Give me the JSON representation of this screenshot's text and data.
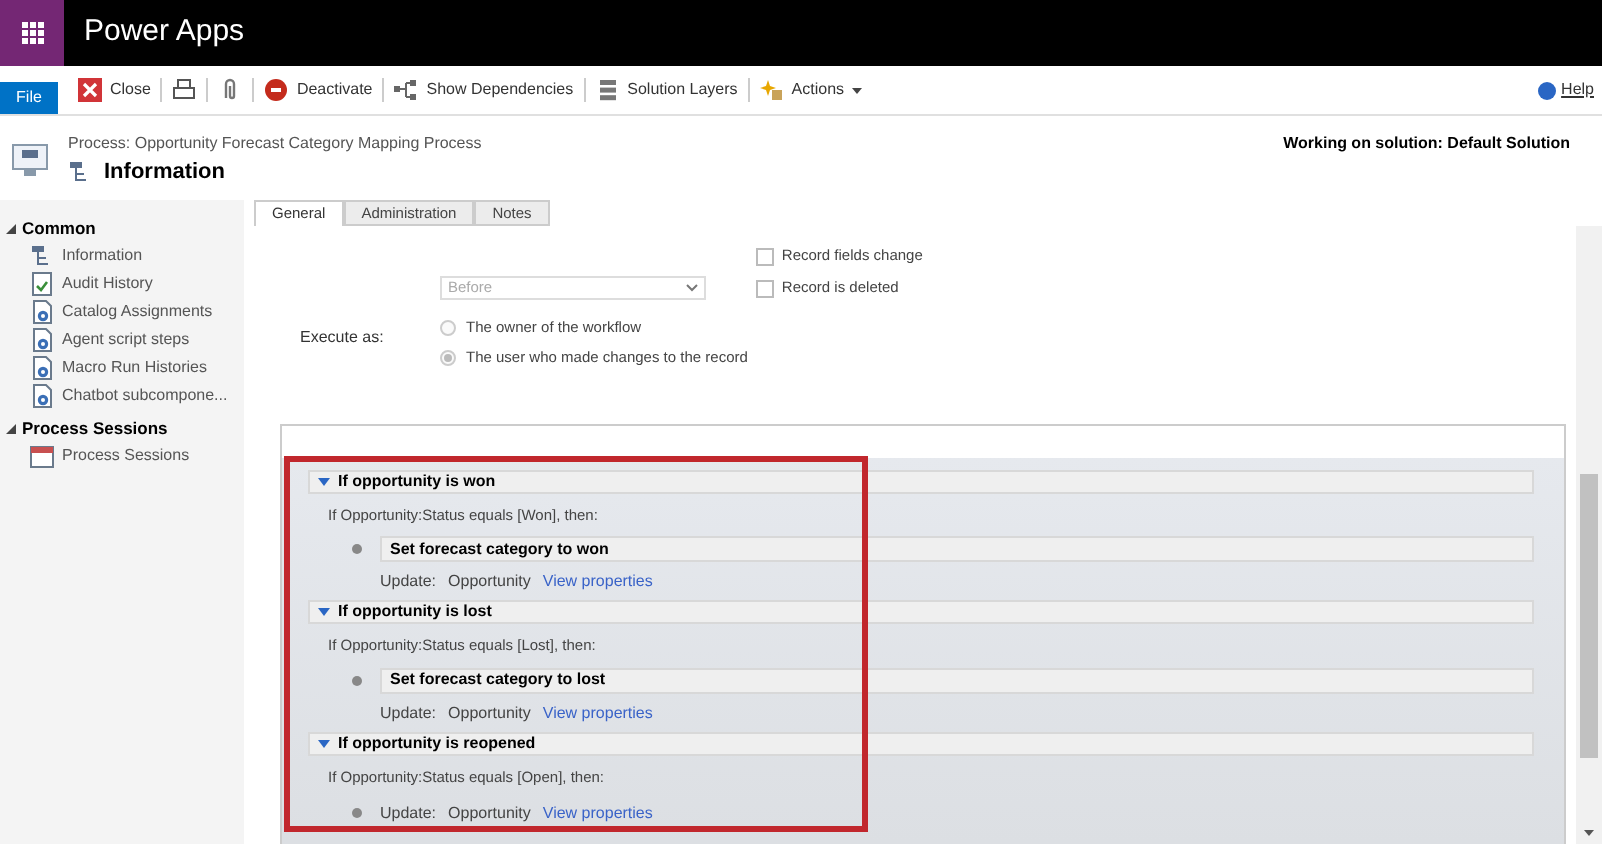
{
  "app": {
    "title": "Power Apps"
  },
  "toolbar": {
    "file": "File",
    "items": [
      {
        "kind": "close",
        "label": "Close"
      },
      {
        "kind": "print"
      },
      {
        "kind": "attach"
      },
      {
        "kind": "deactivate",
        "label": "Deactivate"
      },
      {
        "kind": "dependencies",
        "label": "Show Dependencies"
      },
      {
        "kind": "layers",
        "label": "Solution Layers"
      },
      {
        "kind": "actions",
        "label": "Actions"
      }
    ],
    "help": "Help"
  },
  "header": {
    "breadcrumb": "Process: Opportunity Forecast Category Mapping Process",
    "title": "Information",
    "solution": "Working on solution: Default Solution"
  },
  "sidebar": {
    "sections": [
      {
        "label": "Common",
        "expanded": true,
        "items": [
          {
            "kind": "info",
            "label": "Information"
          },
          {
            "kind": "audit",
            "label": "Audit History"
          },
          {
            "kind": "entity",
            "label": "Catalog Assignments"
          },
          {
            "kind": "entity",
            "label": "Agent script steps"
          },
          {
            "kind": "entity",
            "label": "Macro Run Histories"
          },
          {
            "kind": "entity",
            "label": "Chatbot subcompone..."
          }
        ]
      },
      {
        "label": "Process Sessions",
        "expanded": true,
        "items": [
          {
            "kind": "sessions",
            "label": "Process Sessions"
          }
        ]
      }
    ]
  },
  "tabs": [
    {
      "label": "General",
      "selected": true
    },
    {
      "label": "Administration",
      "selected": false
    },
    {
      "label": "Notes",
      "selected": false
    }
  ],
  "form": {
    "checkboxes": [
      {
        "label": "Record fields change",
        "checked": false
      },
      {
        "label": "Record is deleted",
        "checked": false
      }
    ],
    "dropdown": {
      "value": "Before",
      "disabled": true
    },
    "execute_as": {
      "label": "Execute as:",
      "options": [
        {
          "label": "The owner of the workflow",
          "selected": false
        },
        {
          "label": "The user who made changes to the record",
          "selected": true
        }
      ]
    }
  },
  "steps": [
    {
      "title": "If opportunity is won",
      "expanded": true,
      "condition": "If Opportunity:Status equals [Won], then:",
      "actions": [
        {
          "kind": "step",
          "title": "Set forecast category to won",
          "entity_label": "Update:",
          "entity": "Opportunity",
          "link": "View properties"
        }
      ]
    },
    {
      "title": "If opportunity is lost",
      "expanded": true,
      "condition": "If Opportunity:Status equals [Lost], then:",
      "actions": [
        {
          "kind": "step",
          "title": "Set forecast category to lost",
          "entity_label": "Update:",
          "entity": "Opportunity",
          "link": "View properties"
        }
      ]
    },
    {
      "title": "If opportunity is reopened",
      "expanded": true,
      "condition": "If Opportunity:Status equals [Open], then:",
      "actions": [
        {
          "kind": "update",
          "entity_label": "Update:",
          "entity": "Opportunity",
          "link": "View properties"
        }
      ]
    }
  ]
}
